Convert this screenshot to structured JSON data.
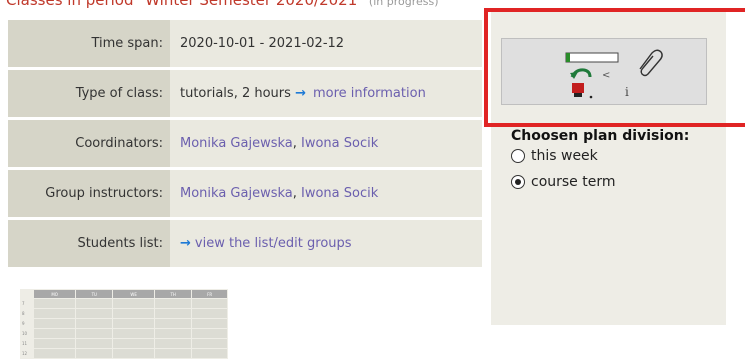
{
  "header": {
    "title": "Classes in period \"Winter Semester 2020/2021\"",
    "status": "(in progress)"
  },
  "info": {
    "time_span_label": "Time span:",
    "time_span_value": "2020-10-01 - 2021-02-12",
    "class_type_label": "Type of class:",
    "class_type_value": "tutorials, 2 hours",
    "class_type_link": "more information",
    "coordinators_label": "Coordinators:",
    "coordinator_1": "Monika Gajewska",
    "coordinator_2": "Iwona Socik",
    "instructors_label": "Group instructors:",
    "instructor_1": "Monika Gajewska",
    "instructor_2": "Iwona Socik",
    "students_label": "Students list:",
    "students_link": "view the list/edit groups"
  },
  "plan": {
    "title": "Choosen plan division:",
    "options": [
      "this week",
      "course term"
    ],
    "selected": "course term",
    "grid_days": [
      "MO",
      "TU",
      "WE",
      "TH",
      "FR"
    ],
    "grid_rows": [
      "7",
      "8",
      "9",
      "10",
      "11",
      "12"
    ]
  },
  "widget": {
    "info_glyph": "i"
  },
  "colors": {
    "title": "#c0392b",
    "link": "#6b5fae",
    "arrow": "#1e7ad6",
    "highlight": "#e02424"
  }
}
